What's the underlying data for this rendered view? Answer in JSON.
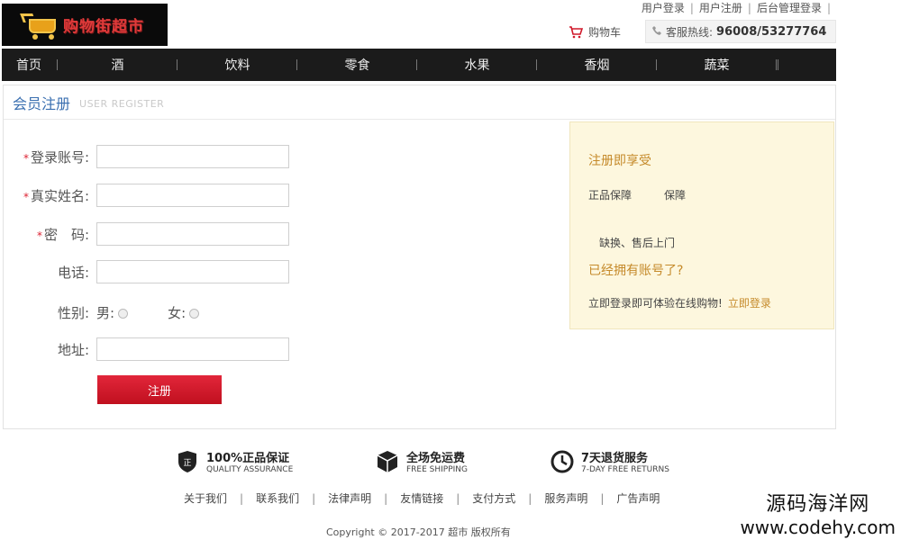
{
  "logo": {
    "text": "购物街超市"
  },
  "top_links": [
    "用户登录",
    "用户注册",
    "后台管理登录"
  ],
  "cart": {
    "label": "购物车"
  },
  "hotline": {
    "label": "客服热线:",
    "number": "96008/53277764"
  },
  "nav": [
    "首页",
    "酒",
    "饮料",
    "零食",
    "水果",
    "香烟",
    "蔬菜"
  ],
  "register": {
    "title": "会员注册",
    "subtitle": "USER REGISTER",
    "fields": {
      "account": {
        "label": "登录账号:",
        "required": "*"
      },
      "realname": {
        "label": "真实姓名:",
        "required": "*"
      },
      "password": {
        "label": "密　码:",
        "required": "*"
      },
      "phone": {
        "label": "电话:"
      },
      "gender": {
        "label": "性别:",
        "male": "男:",
        "female": "女:"
      },
      "address": {
        "label": "地址:"
      }
    },
    "submit_label": "注册"
  },
  "side": {
    "title": "注册即享受",
    "line1": "正品保障　　　保障",
    "line2": "　缺换、售后上门",
    "have_account": "已经拥有账号了?",
    "login_text": "立即登录即可体验在线购物!",
    "login_link": "立即登录"
  },
  "guarantees": [
    {
      "title": "100%正品保证",
      "sub": "QUALITY ASSURANCE",
      "icon": "shield-icon"
    },
    {
      "title": "全场免运费",
      "sub": "FREE SHIPPING",
      "icon": "box-icon"
    },
    {
      "title": "7天退货服务",
      "sub": "7-DAY FREE RETURNS",
      "icon": "clock-icon"
    }
  ],
  "footer_links": [
    "关于我们",
    "联系我们",
    "法律声明",
    "友情链接",
    "支付方式",
    "服务声明",
    "广告声明"
  ],
  "copyright": "Copyright © 2017-2017 超市 版权所有",
  "watermark": {
    "line1": "源码海洋网",
    "line2": "www.codehy.com"
  },
  "colors": {
    "nav_bg": "#1b1b1b",
    "accent_blue": "#3a6fb0",
    "submit_red": "#d41a2c",
    "side_bg": "#fdf7de"
  }
}
